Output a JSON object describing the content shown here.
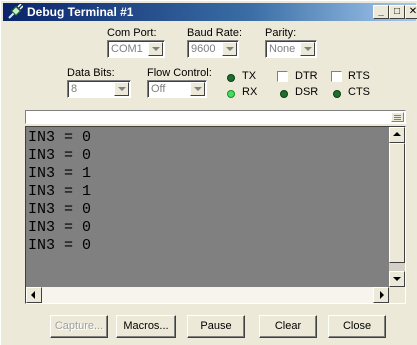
{
  "window": {
    "title": "Debug Terminal #1",
    "icon": "cable-plug-icon",
    "controls": {
      "minimize": "_",
      "maximize": "□",
      "close": "✕"
    }
  },
  "settings": {
    "com_port": {
      "label": "Com Port:",
      "value": "COM1"
    },
    "baud_rate": {
      "label": "Baud Rate:",
      "value": "9600"
    },
    "parity": {
      "label": "Parity:",
      "value": "None"
    },
    "data_bits": {
      "label": "Data Bits:",
      "value": "8"
    },
    "flow_control": {
      "label": "Flow Control:",
      "value": "Off"
    }
  },
  "indicators": {
    "tx": {
      "label": "TX",
      "color": "#1f6e2b"
    },
    "rx": {
      "label": "RX",
      "color": "#42e05a"
    },
    "dsr": {
      "label": "DSR",
      "color": "#1f6e2b"
    },
    "cts": {
      "label": "CTS",
      "color": "#1f6e2b"
    },
    "dtr": {
      "label": "DTR",
      "checked": false
    },
    "rts": {
      "label": "RTS",
      "checked": false
    }
  },
  "transmit": {
    "value": ""
  },
  "console": {
    "lines": [
      "IN3 = 0",
      "IN3 = 0",
      "IN3 = 1",
      "IN3 = 1",
      "IN3 = 0",
      "IN3 = 0",
      "IN3 = 0"
    ],
    "background": "#808080"
  },
  "buttons": {
    "capture": "Capture...",
    "macros": "Macros...",
    "pause": "Pause",
    "clear": "Clear",
    "close": "Close"
  }
}
